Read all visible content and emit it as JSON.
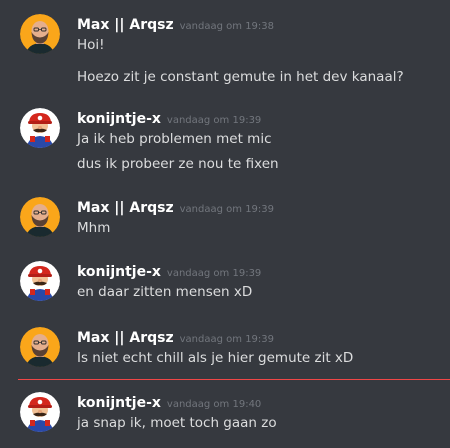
{
  "messages": [
    {
      "user": "Max || Arqsz",
      "avatar": "bald-bearded-man-avatar",
      "timestamp": "vandaag om 19:38",
      "lines": [
        "Hoi!",
        "Hoezo zit je constant gemute in het dev kanaal?"
      ]
    },
    {
      "user": "konijntje-x",
      "avatar": "mario-avatar",
      "timestamp": "vandaag om 19:39",
      "lines": [
        "Ja ik heb problemen met mic",
        "dus ik probeer ze nou te fixen"
      ]
    },
    {
      "user": "Max || Arqsz",
      "avatar": "bald-bearded-man-avatar",
      "timestamp": "vandaag om 19:39",
      "lines": [
        "Mhm"
      ]
    },
    {
      "user": "konijntje-x",
      "avatar": "mario-avatar",
      "timestamp": "vandaag om 19:39",
      "lines": [
        "en daar zitten mensen xD"
      ]
    },
    {
      "user": "Max || Arqsz",
      "avatar": "bald-bearded-man-avatar",
      "timestamp": "vandaag om 19:39",
      "lines": [
        "Is niet echt chill als je hier gemute zit xD"
      ]
    },
    {
      "user": "konijntje-x",
      "avatar": "mario-avatar",
      "timestamp": "vandaag om 19:40",
      "lines": [
        "ja snap ik, moet toch gaan zo"
      ]
    }
  ],
  "colors": {
    "background": "#36393f",
    "username": "#ffffff",
    "timestamp": "#72767d",
    "message_text": "#dcddde",
    "new_messages_divider": "#f04747",
    "max_avatar_bg": "#faa61a",
    "mario_avatar_bg": "#ffffff"
  }
}
